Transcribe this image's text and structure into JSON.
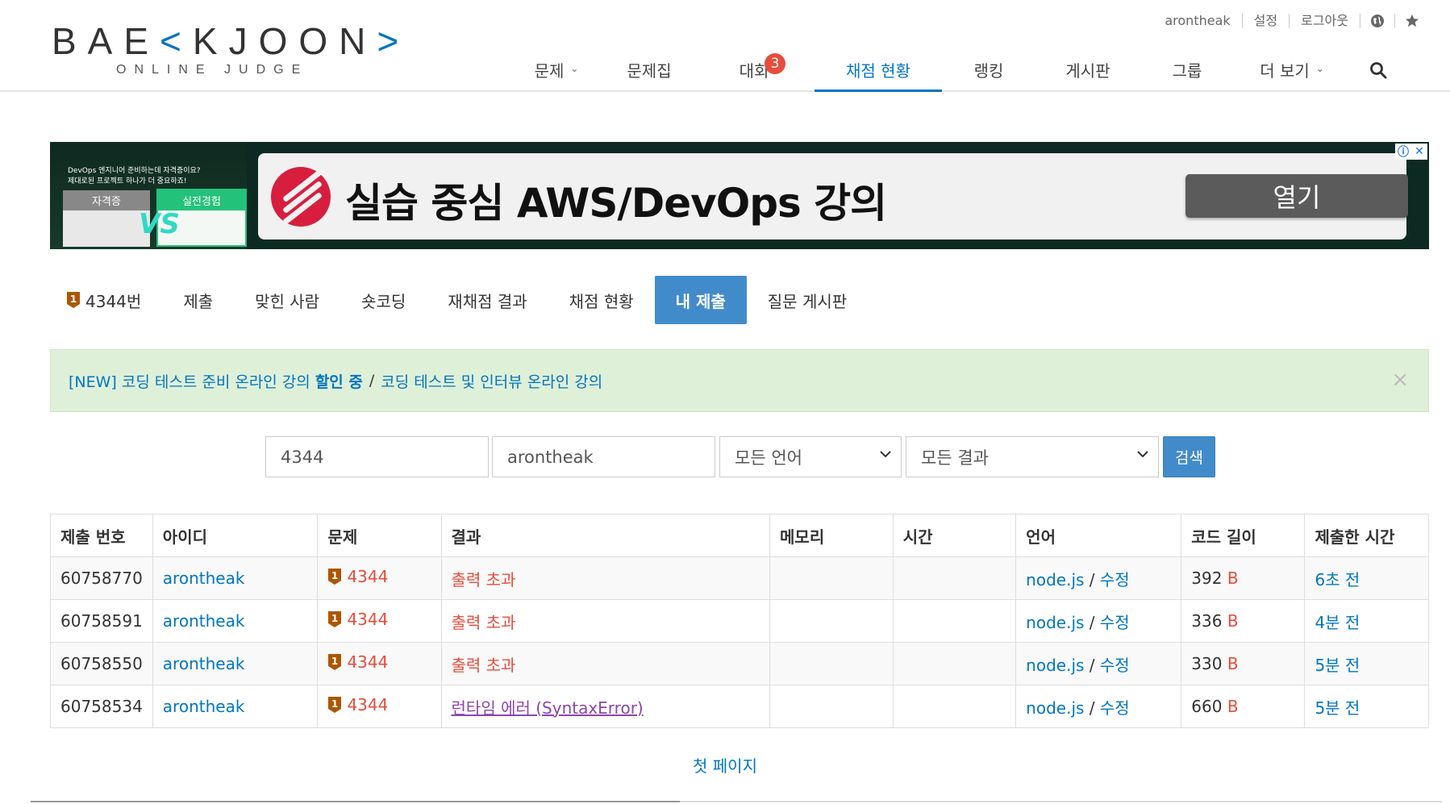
{
  "logo": {
    "main_a": "BAE",
    "main_k": "K",
    "main_b": "JOON",
    "sub": "ONLINE JUDGE"
  },
  "topbar": {
    "user": "arontheak",
    "settings": "설정",
    "logout": "로그아웃"
  },
  "nav": {
    "problems": "문제",
    "workbook": "문제집",
    "contest": "대회",
    "contest_badge": "3",
    "status": "채점 현황",
    "ranking": "랭킹",
    "board": "게시판",
    "group": "그룹",
    "more": "더 보기"
  },
  "ad": {
    "side_text_1": "DevOps 엔지니어 준비하는데 자격증이요?",
    "side_text_2": "제대로된 프로젝트 하나가 더 중요하죠!",
    "card_a": "자격증",
    "card_b": "실전경험",
    "vs": "VS",
    "headline": "실습 중심 AWS/DevOps 강의",
    "button": "열기"
  },
  "problem_tabs": {
    "number": "4344번",
    "submit": "제출",
    "solved": "맞힌 사람",
    "short": "숏코딩",
    "rejudge": "재채점 결과",
    "status": "채점 현황",
    "mine": "내 제출",
    "qna": "질문 게시판"
  },
  "alert": {
    "part1": "[NEW] 코딩 테스트 준비 온라인 강의 ",
    "part1_bold": "할인 중",
    "separator": "/",
    "part2": "코딩 테스트 및 인터뷰 온라인 강의",
    "close": "×"
  },
  "search": {
    "problem_id": "4344",
    "user_id": "arontheak",
    "language": "모든 언어",
    "result": "모든 결과",
    "button": "검색"
  },
  "table": {
    "headers": [
      "제출 번호",
      "아이디",
      "문제",
      "결과",
      "메모리",
      "시간",
      "언어",
      "코드 길이",
      "제출한 시간"
    ],
    "rows": [
      {
        "id": "60758770",
        "user": "arontheak",
        "problem": "4344",
        "result": "출력 초과",
        "memory": "",
        "time": "",
        "lang": "node.js",
        "edit": "수정",
        "length": "392",
        "unit": "B",
        "submitted": "6초 전"
      },
      {
        "id": "60758591",
        "user": "arontheak",
        "problem": "4344",
        "result": "출력 초과",
        "memory": "",
        "time": "",
        "lang": "node.js",
        "edit": "수정",
        "length": "336",
        "unit": "B",
        "submitted": "4분 전"
      },
      {
        "id": "60758550",
        "user": "arontheak",
        "problem": "4344",
        "result": "출력 초과",
        "memory": "",
        "time": "",
        "lang": "node.js",
        "edit": "수정",
        "length": "330",
        "unit": "B",
        "submitted": "5분 전"
      },
      {
        "id": "60758534",
        "user": "arontheak",
        "problem": "4344",
        "result": "런타임 에러 (SyntaxError)",
        "memory": "",
        "time": "",
        "lang": "node.js",
        "edit": "수정",
        "length": "660",
        "unit": "B",
        "submitted": "5분 전"
      }
    ]
  },
  "pager": {
    "first": "첫 페이지"
  },
  "colors": {
    "brand": "#0076c0",
    "tab_active": "#428bca",
    "error": "#e74c3c",
    "alert_bg": "#dff0d8",
    "ad_red": "#d81e3f"
  },
  "icons": [
    "globe-icon",
    "star-icon",
    "search-icon",
    "chevron-down-icon",
    "bronze-tier-icon",
    "close-icon",
    "info-icon"
  ]
}
